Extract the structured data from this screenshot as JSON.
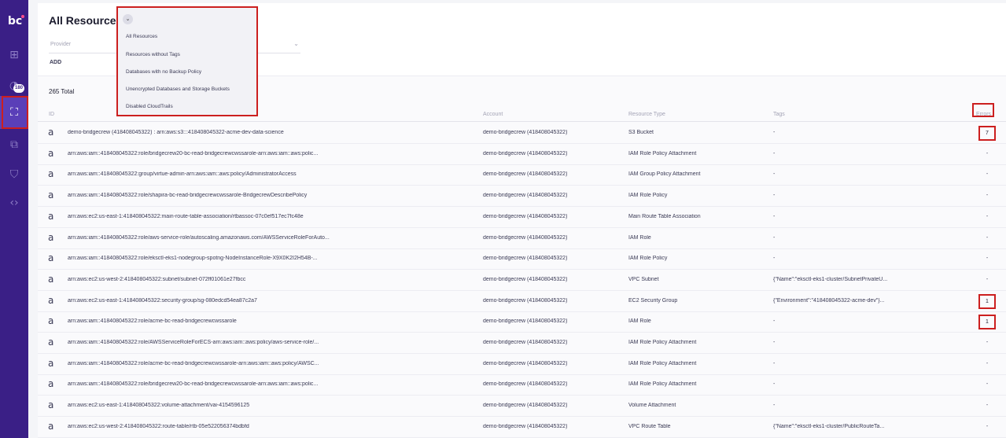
{
  "app": {
    "logo_text": "bc"
  },
  "sidebar": {
    "badge_count": "180",
    "icons": [
      "dashboard-icon",
      "radar-icon",
      "resources-icon",
      "puzzle-icon",
      "shield-icon",
      "code-icon"
    ]
  },
  "header": {
    "title": "All Resources",
    "filter_placeholder": "Provider",
    "add_label": "ADD"
  },
  "dropdown": {
    "items": [
      "All Resources",
      "Resources without Tags",
      "Databases with no Backup Policy",
      "Unencrypted Databases and Storage Buckets",
      "Disabled CloudTrails"
    ]
  },
  "table": {
    "total_label": "265 Total",
    "columns": {
      "id": "ID",
      "account": "Account",
      "type": "Resource Type",
      "tags": "Tags",
      "errors": "Errors"
    },
    "rows": [
      {
        "id": "demo-bridgecrew (418408045322) : arn:aws:s3:::418408045322-acme-dev-data-science",
        "account": "demo-bridgecrew (418408045322)",
        "type": "S3 Bucket",
        "tags": "-",
        "errors": "7",
        "flag": true
      },
      {
        "id": "arn:aws:iam::418408045322:role/bridgecrew20-bc-read-bridgecrewcwssarole-arn:aws:iam::aws:polic...",
        "account": "demo-bridgecrew (418408045322)",
        "type": "IAM Role Policy Attachment",
        "tags": "-",
        "errors": "-",
        "flag": false
      },
      {
        "id": "arn:aws:iam::418408045322:group/virtue-admin-arn:aws:iam::aws:policy/AdministratorAccess",
        "account": "demo-bridgecrew (418408045322)",
        "type": "IAM Group Policy Attachment",
        "tags": "-",
        "errors": "-",
        "flag": false
      },
      {
        "id": "arn:aws:iam::418408045322:role/shapira-bc-read-bridgecrewcwssarole-BridgecrewDescribePolicy",
        "account": "demo-bridgecrew (418408045322)",
        "type": "IAM Role Policy",
        "tags": "-",
        "errors": "-",
        "flag": false
      },
      {
        "id": "arn:aws:ec2:us-east-1:418408045322:main-route-table-association/rtbassoc-07c0ef517ec7fc48e",
        "account": "demo-bridgecrew (418408045322)",
        "type": "Main Route Table Association",
        "tags": "-",
        "errors": "-",
        "flag": false
      },
      {
        "id": "arn:aws:iam::418408045322:role/aws-service-role/autoscaling.amazonaws.com/AWSServiceRoleForAuto...",
        "account": "demo-bridgecrew (418408045322)",
        "type": "IAM Role",
        "tags": "-",
        "errors": "-",
        "flag": false
      },
      {
        "id": "arn:aws:iam::418408045322:role/eksctl-eks1-nodegroup-spotng-NodeInstanceRole-X9X0K2I2H54B-...",
        "account": "demo-bridgecrew (418408045322)",
        "type": "IAM Role Policy",
        "tags": "-",
        "errors": "-",
        "flag": false
      },
      {
        "id": "arn:aws:ec2:us-west-2:418408045322:subnet/subnet-072ff01061e27fbcc",
        "account": "demo-bridgecrew (418408045322)",
        "type": "VPC Subnet",
        "tags": "{\"Name\":\"eksctl-eks1-cluster/SubnetPrivateU...",
        "errors": "-",
        "flag": false
      },
      {
        "id": "arn:aws:ec2:us-east-1:418408045322:security-group/sg-080edcd54ea87c2a7",
        "account": "demo-bridgecrew (418408045322)",
        "type": "EC2 Security Group",
        "tags": "{\"Environment\":\"418408045322-acme-dev\"}...",
        "errors": "1",
        "flag": true
      },
      {
        "id": "arn:aws:iam::418408045322:role/acme-bc-read-bridgecrewcwssarole",
        "account": "demo-bridgecrew (418408045322)",
        "type": "IAM Role",
        "tags": "-",
        "errors": "1",
        "flag": true
      },
      {
        "id": "arn:aws:iam::418408045322:role/AWSServiceRoleForECS-arn:aws:iam::aws:policy/aws-service-role/...",
        "account": "demo-bridgecrew (418408045322)",
        "type": "IAM Role Policy Attachment",
        "tags": "-",
        "errors": "-",
        "flag": false
      },
      {
        "id": "arn:aws:iam::418408045322:role/acme-bc-read-bridgecrewcwssarole-arn:aws:iam::aws:policy/AWSC...",
        "account": "demo-bridgecrew (418408045322)",
        "type": "IAM Role Policy Attachment",
        "tags": "-",
        "errors": "-",
        "flag": false
      },
      {
        "id": "arn:aws:iam::418408045322:role/bridgecrew20-bc-read-bridgecrewcwssarole-arn:aws:iam::aws:polic...",
        "account": "demo-bridgecrew (418408045322)",
        "type": "IAM Role Policy Attachment",
        "tags": "-",
        "errors": "-",
        "flag": false
      },
      {
        "id": "arn:aws:ec2:us-east-1:418408045322:volume-attachment/vai-4154596125",
        "account": "demo-bridgecrew (418408045322)",
        "type": "Volume Attachment",
        "tags": "-",
        "errors": "-",
        "flag": false
      },
      {
        "id": "arn:aws:ec2:us-west-2:418408045322:route-table/rtb-05e522056374bdbfd",
        "account": "demo-bridgecrew (418408045322)",
        "type": "VPC Route Table",
        "tags": "{\"Name\":\"eksctl-eks1-cluster/PublicRouteTa...",
        "errors": "-",
        "flag": false
      }
    ]
  },
  "colors": {
    "sidebar": "#3a1f86",
    "sidebar_active": "#5a3fb8",
    "highlight": "#cc1f1f"
  }
}
